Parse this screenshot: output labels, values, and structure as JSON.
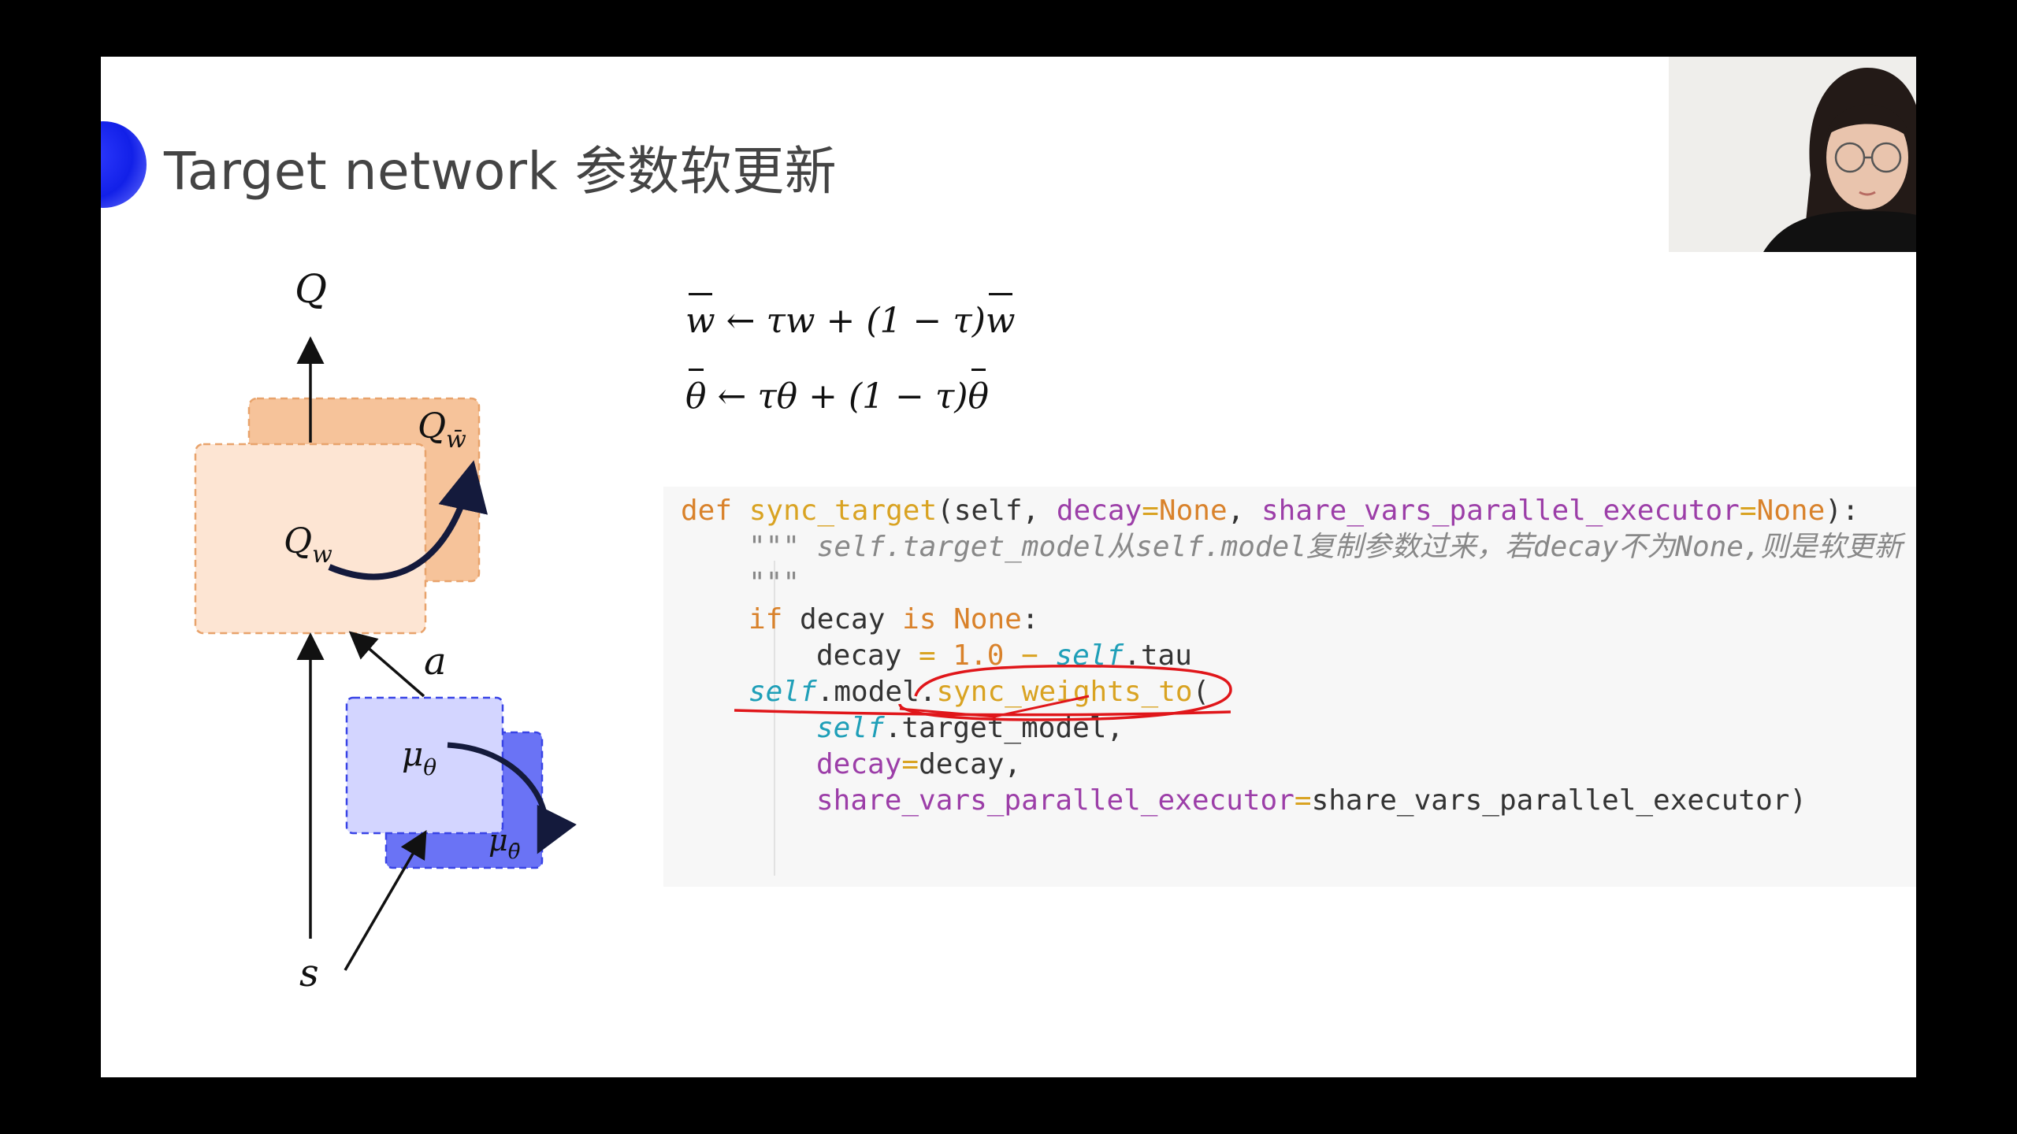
{
  "slide": {
    "title": "Target network 参数软更新"
  },
  "diagram": {
    "output_label": "Q",
    "critic_target_label": "Q",
    "critic_target_sub": "w̄",
    "critic_label": "Q",
    "critic_sub": "w",
    "action_label": "a",
    "actor_label": "μ",
    "actor_sub": "θ",
    "actor_target_label": "μ",
    "actor_target_sub": "θ̄",
    "state_label": "s",
    "colors": {
      "critic_target_fill": "#f6c39a",
      "critic_fill": "#fde5d3",
      "critic_border": "#e8a36c",
      "actor_fill": "#d3d5ff",
      "actor_target_fill": "#6a73f5",
      "actor_border": "#3944e6",
      "arrow": "#111111",
      "curve": "#141a3c"
    }
  },
  "formulas": {
    "line1": {
      "lhs": "w",
      "rest": " ← τw + (1 − τ)",
      "tail": "w"
    },
    "line2": {
      "lhs": "θ",
      "rest": " ← τθ + (1 − τ)",
      "tail": "θ"
    }
  },
  "code": {
    "l1": {
      "kw": "def",
      "fn": "sync_target",
      "p1": "(self, ",
      "decay": "decay",
      "eq1": "=",
      "none1": "None",
      "comma": ", ",
      "share": "share_vars_parallel_executor",
      "eq2": "=",
      "none2": "None",
      "end": "):"
    },
    "l2": {
      "quote": "\"\"\"",
      "text": " self.target_model从self.model复制参数过来，若decay不为None,则是软更新"
    },
    "l3": {
      "quote": "\"\"\""
    },
    "l4": {
      "kw": "if",
      "var": " decay ",
      "is": "is",
      "none": " None",
      "colon": ":"
    },
    "l5": {
      "var": "decay ",
      "eq": "=",
      "num": " 1.0",
      "minus": " −",
      "self": " self",
      "rest": ".tau"
    },
    "l6": {
      "self": "self",
      "rest": ".model",
      "dot": ".",
      "fn": "sync_weights_to",
      "paren": "("
    },
    "l7": {
      "self": "self",
      "rest": ".target_model,"
    },
    "l8": {
      "param": "decay",
      "eq": "=",
      "rest": "decay,"
    },
    "l9": {
      "param": "share_vars_parallel_executor",
      "eq": "=",
      "rest": "share_vars_parallel_executor)"
    }
  },
  "annotation": {
    "color": "#e0161a"
  },
  "webcam": {
    "background": "#efeeeb"
  }
}
